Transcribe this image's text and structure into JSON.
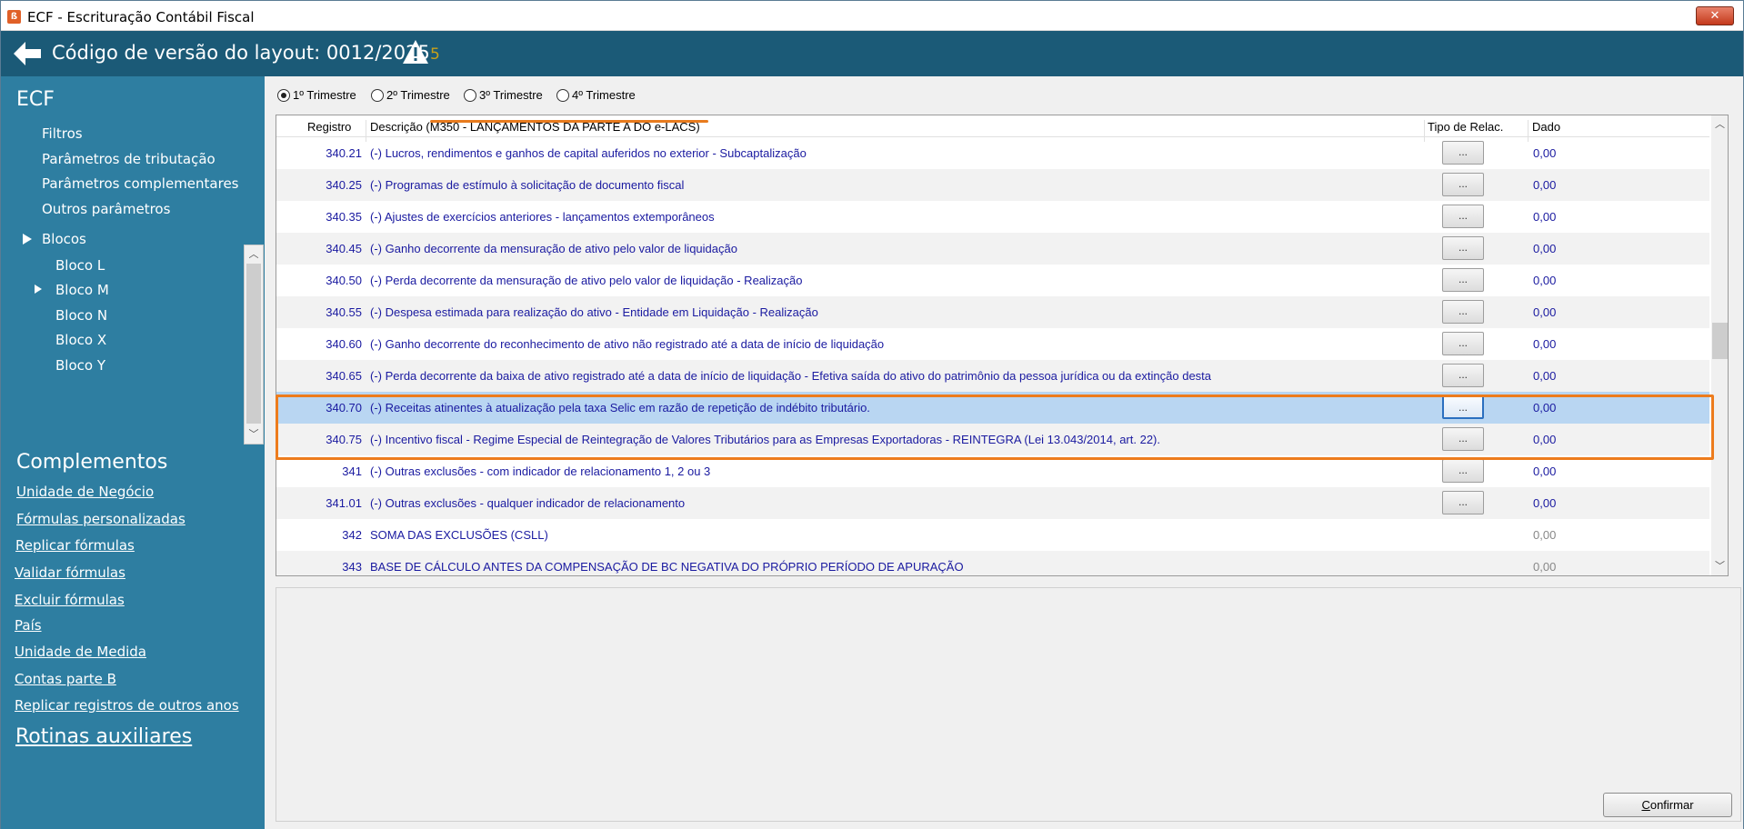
{
  "window": {
    "title": "ECF - Escrituração Contábil Fiscal",
    "app_icon_glyph": "ß",
    "close_glyph": "✕"
  },
  "header": {
    "title": "Código de versão do layout: 0012/2025",
    "warning_count": "5"
  },
  "sidebar": {
    "ecf_heading": "ECF",
    "ecf_items": [
      "Filtros",
      "Parâmetros de tributação",
      "Parâmetros complementares",
      "Outros parâmetros"
    ],
    "blocos_label": "Blocos",
    "blocos_items": [
      "Bloco L",
      "Bloco M",
      "Bloco N",
      "Bloco X",
      "Bloco Y"
    ],
    "complementos_heading": "Complementos",
    "complementos_links": [
      "Unidade de Negócio",
      "Fórmulas personalizadas",
      "Replicar fórmulas",
      "Validar fórmulas",
      "Excluir fórmulas",
      "País",
      "Unidade de Medida",
      "Contas parte B",
      "Replicar registros de outros anos"
    ],
    "rotinas_heading": "Rotinas auxiliares"
  },
  "quarters": [
    "1º Trimestre",
    "2º Trimestre",
    "3º Trimestre",
    "4º Trimestre"
  ],
  "selected_quarter": "1º Trimestre",
  "grid": {
    "headers": {
      "registro": "Registro",
      "descricao_prefix": "Descrição (",
      "descricao_highlight": "M350 - LANÇAMENTOS DA PARTE A DO e-LACS",
      "descricao_suffix": ")",
      "tipo": "Tipo de Relac.",
      "dado": "Dado"
    },
    "button_label": "...",
    "rows": [
      {
        "reg": "340.21",
        "desc": "(-) Lucros, rendimentos e ganhos de capital auferidos no exterior - Subcaptalização",
        "dado": "0,00"
      },
      {
        "reg": "340.25",
        "desc": "(-) Programas de estímulo à solicitação de documento fiscal",
        "dado": "0,00"
      },
      {
        "reg": "340.35",
        "desc": "(-) Ajustes de exercícios anteriores - lançamentos extemporâneos",
        "dado": "0,00"
      },
      {
        "reg": "340.45",
        "desc": "(-) Ganho decorrente da mensuração de ativo pelo valor de liquidação",
        "dado": "0,00"
      },
      {
        "reg": "340.50",
        "desc": "(-) Perda decorrente da mensuração de ativo pelo valor de liquidação - Realização",
        "dado": "0,00"
      },
      {
        "reg": "340.55",
        "desc": "(-) Despesa estimada para realização do ativo - Entidade em Liquidação - Realização",
        "dado": "0,00"
      },
      {
        "reg": "340.60",
        "desc": "(-) Ganho decorrente do reconhecimento de ativo não registrado até a data de início de liquidação",
        "dado": "0,00"
      },
      {
        "reg": "340.65",
        "desc": "(-) Perda decorrente da baixa de ativo registrado até a data de início de liquidação - Efetiva saída do ativo do patrimônio da pessoa jurídica ou da extinção desta",
        "dado": "0,00"
      },
      {
        "reg": "340.70",
        "desc": "(-) Receitas atinentes à atualização pela taxa Selic em razão de repetição de indébito tributário.",
        "dado": "0,00"
      },
      {
        "reg": "340.75",
        "desc": "(-) Incentivo fiscal - Regime Especial de Reintegração de Valores Tributários para as Empresas Exportadoras - REINTEGRA (Lei 13.043/2014, art. 22).",
        "dado": "0,00"
      },
      {
        "reg": "341",
        "desc": "(-) Outras exclusões - com indicador de relacionamento 1, 2 ou 3",
        "dado": "0,00"
      },
      {
        "reg": "341.01",
        "desc": "(-) Outras exclusões - qualquer indicador de relacionamento",
        "dado": "0,00"
      },
      {
        "reg": "342",
        "desc": "SOMA DAS EXCLUSÕES (CSLL)",
        "dado": "0,00"
      },
      {
        "reg": "343",
        "desc": "BASE DE CÁLCULO ANTES DA COMPENSAÇÃO DE BC NEGATIVA DO PRÓPRIO PERÍODO DE APURAÇÃO",
        "dado": "0,00"
      }
    ]
  },
  "confirm": {
    "first_letter": "C",
    "rest": "onfirmar"
  },
  "colors": {
    "header_bg": "#1b5a77",
    "sidebar_bg": "#2e7ea1",
    "highlight_orange": "#ed7c1d",
    "selected_row": "#b9d6f2",
    "row_text": "#1a1aa0"
  },
  "icons": {
    "back": "arrow-left-icon",
    "warning": "warning-triangle-icon",
    "expand": "triangle-right-icon"
  }
}
